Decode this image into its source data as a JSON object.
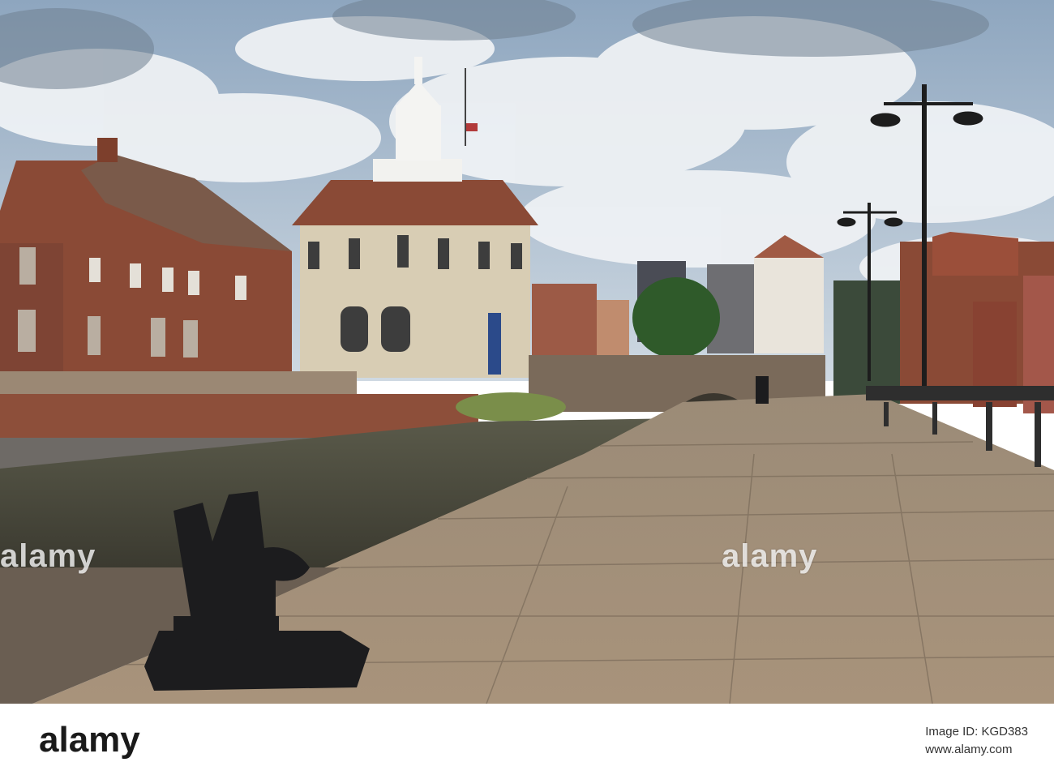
{
  "watermarks": {
    "left": "alamy",
    "center": "alamy"
  },
  "footer": {
    "logo": "alamy",
    "image_id_line": "Image ID: KGD383",
    "site_line": "www.alamy.com"
  },
  "colors": {
    "sky": "#b9c9d8",
    "cloud": "#eef1f4",
    "brick": "#8a4a36",
    "stone_facade": "#d8cdb4",
    "water": "#4a4a3c",
    "pavement": "#a08e78",
    "bollard": "#1c1c1e"
  }
}
